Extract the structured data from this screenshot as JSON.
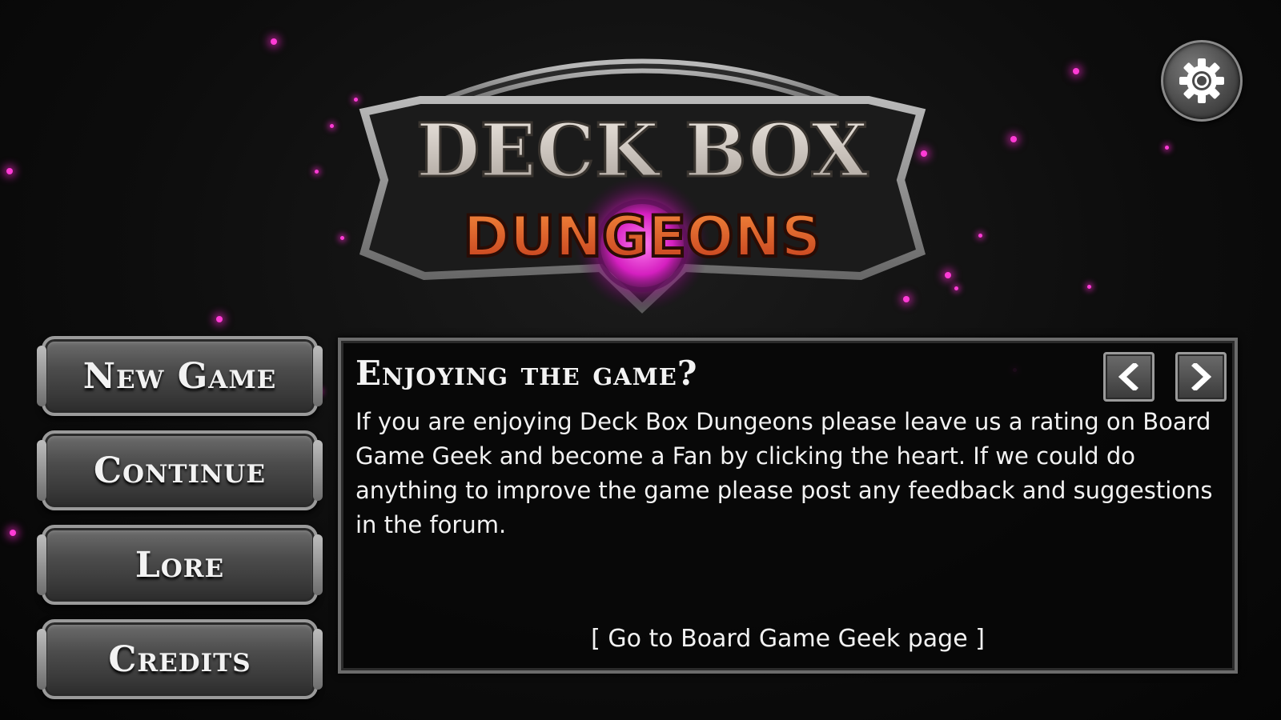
{
  "logo": {
    "line1": "DECK BOX",
    "line2": "DUNGEONS"
  },
  "settings": {
    "icon": "gear-icon"
  },
  "menu": {
    "items": [
      {
        "label": "New Game"
      },
      {
        "label": "Continue"
      },
      {
        "label": "Lore"
      },
      {
        "label": "Credits"
      }
    ]
  },
  "panel": {
    "title": "Enjoying the game?",
    "body": "If you are enjoying Deck Box Dungeons please leave us a rating on Board Game Geek and become a Fan by clicking the heart. If we could do anything to improve the game please post any feedback and suggestions in the forum.",
    "link": "[ Go to Board Game Geek page ]",
    "prev_icon": "chevron-left-icon",
    "next_icon": "chevron-right-icon"
  },
  "colors": {
    "accent_magenta": "#ff3bd6",
    "logo_orange": "#e2572a",
    "stone": "#d8d2cc"
  }
}
